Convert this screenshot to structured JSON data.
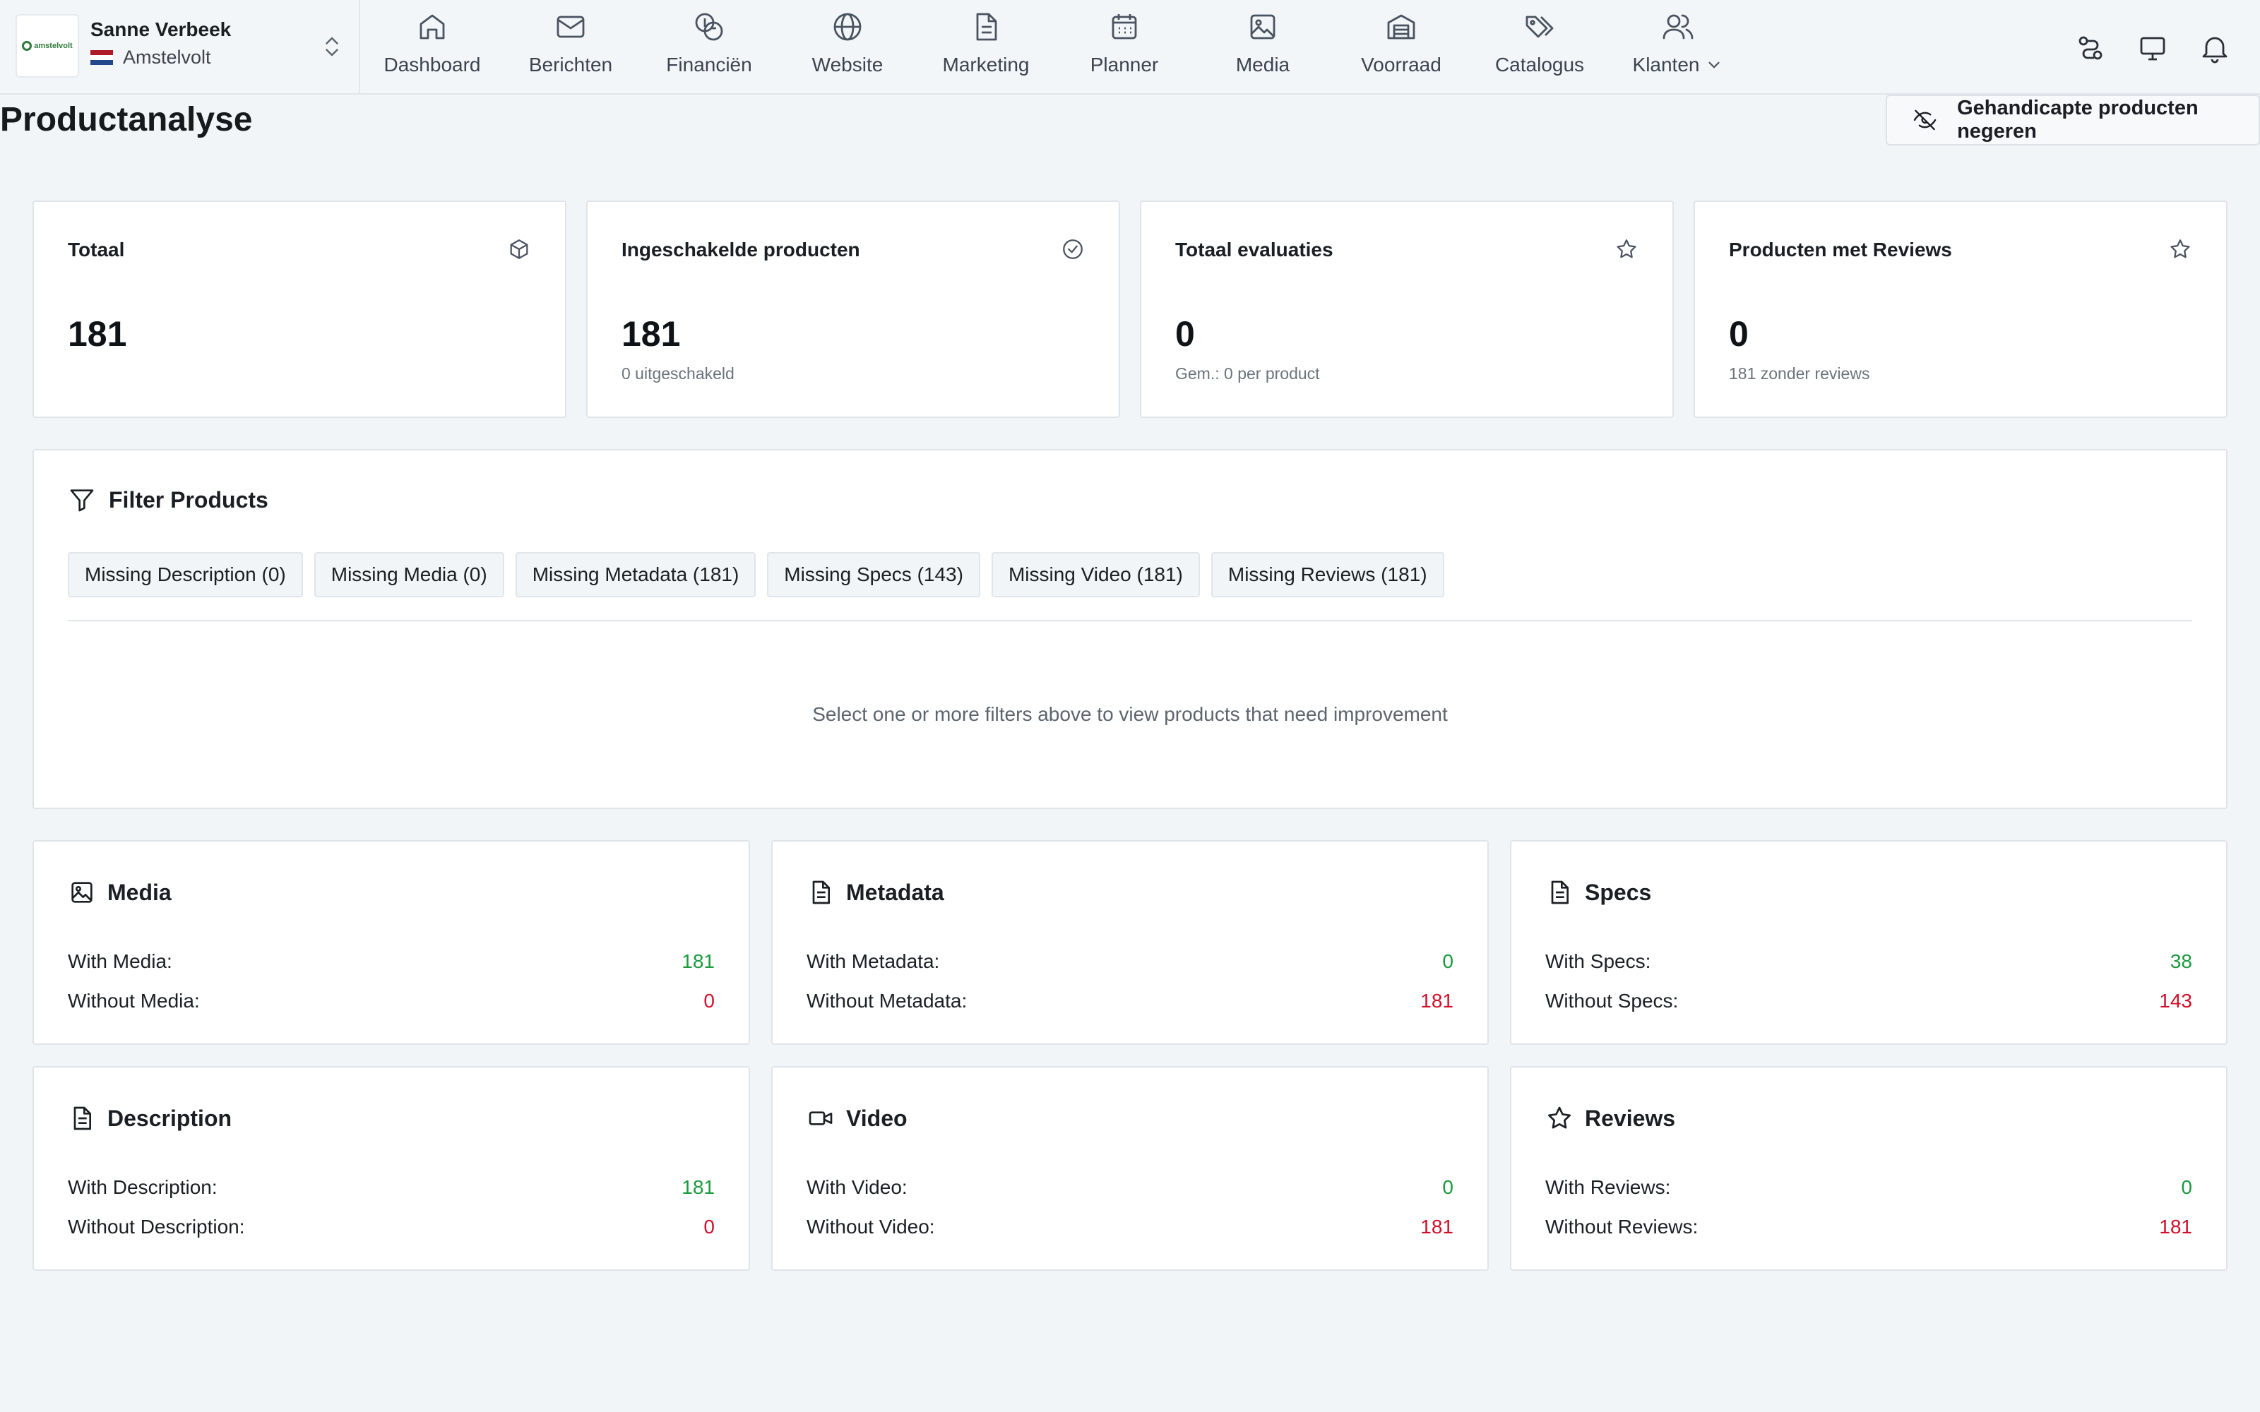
{
  "account": {
    "name": "Sanne Verbeek",
    "store": "Amstelvolt",
    "logo_text": "amstelvolt"
  },
  "nav": [
    {
      "label": "Dashboard",
      "icon": "home-icon"
    },
    {
      "label": "Berichten",
      "icon": "mail-icon"
    },
    {
      "label": "Financiën",
      "icon": "coins-icon"
    },
    {
      "label": "Website",
      "icon": "globe-icon"
    },
    {
      "label": "Marketing",
      "icon": "document-icon"
    },
    {
      "label": "Planner",
      "icon": "calendar-icon"
    },
    {
      "label": "Media",
      "icon": "image-icon"
    },
    {
      "label": "Voorraad",
      "icon": "warehouse-icon"
    },
    {
      "label": "Catalogus",
      "icon": "tags-icon"
    },
    {
      "label": "Klanten",
      "icon": "users-icon"
    }
  ],
  "page": {
    "title": "Productanalyse",
    "ignore_button": "Gehandicapte producten negeren"
  },
  "stats": [
    {
      "title": "Totaal",
      "value": "181",
      "sub": "",
      "icon": "box-icon"
    },
    {
      "title": "Ingeschakelde producten",
      "value": "181",
      "sub": "0 uitgeschakeld",
      "icon": "check-circle-icon"
    },
    {
      "title": "Totaal evaluaties",
      "value": "0",
      "sub": "Gem.: 0 per product",
      "icon": "star-icon"
    },
    {
      "title": "Producten met Reviews",
      "value": "0",
      "sub": "181 zonder reviews",
      "icon": "star-icon"
    }
  ],
  "filter": {
    "title": "Filter Products",
    "chips": [
      "Missing Description (0)",
      "Missing Media (0)",
      "Missing Metadata (181)",
      "Missing Specs (143)",
      "Missing Video (181)",
      "Missing Reviews (181)"
    ],
    "empty_message": "Select one or more filters above to view products that need improvement"
  },
  "breakdown": [
    {
      "title": "Media",
      "icon": "image-icon",
      "with_label": "With Media:",
      "with_value": "181",
      "without_label": "Without Media:",
      "without_value": "0"
    },
    {
      "title": "Metadata",
      "icon": "file-text-icon",
      "with_label": "With Metadata:",
      "with_value": "0",
      "without_label": "Without Metadata:",
      "without_value": "181"
    },
    {
      "title": "Specs",
      "icon": "file-text-icon",
      "with_label": "With Specs:",
      "with_value": "38",
      "without_label": "Without Specs:",
      "without_value": "143"
    },
    {
      "title": "Description",
      "icon": "file-text-icon",
      "with_label": "With Description:",
      "with_value": "181",
      "without_label": "Without Description:",
      "without_value": "0"
    },
    {
      "title": "Video",
      "icon": "video-icon",
      "with_label": "With Video:",
      "with_value": "0",
      "without_label": "Without Video:",
      "without_value": "181"
    },
    {
      "title": "Reviews",
      "icon": "star-icon",
      "with_label": "With Reviews:",
      "with_value": "0",
      "without_label": "Without Reviews:",
      "without_value": "181"
    }
  ],
  "colors": {
    "positive": "#1a9a3c",
    "negative": "#d0102a",
    "background": "#f1f5f8"
  }
}
